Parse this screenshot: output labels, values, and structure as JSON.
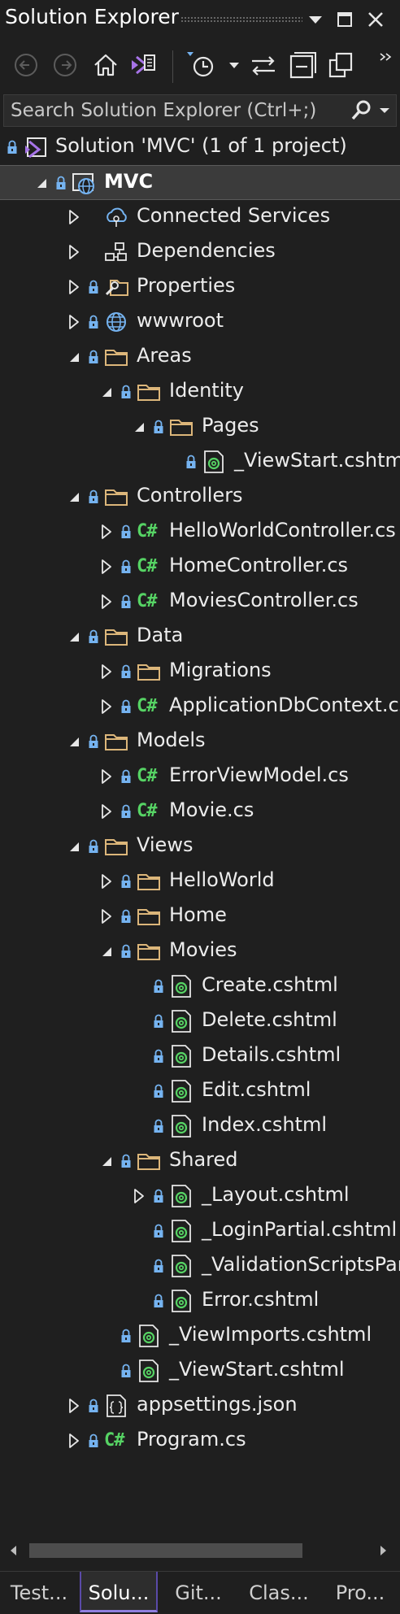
{
  "window": {
    "title": "Solution Explorer"
  },
  "search": {
    "placeholder": "Search Solution Explorer (Ctrl+;)"
  },
  "tree": [
    {
      "label": "Solution 'MVC' (1 of 1 project)",
      "icon": "solution-icon",
      "expander": "none",
      "lock": true,
      "selected": false,
      "depth": 0
    },
    {
      "label": "MVC",
      "icon": "web-project-icon",
      "expander": "expanded",
      "lock": true,
      "selected": true,
      "bold": true,
      "depth": 1
    },
    {
      "label": "Connected Services",
      "icon": "connected-services-icon",
      "expander": "collapsed",
      "lock": false,
      "depth": 2
    },
    {
      "label": "Dependencies",
      "icon": "dependencies-icon",
      "expander": "collapsed",
      "lock": false,
      "depth": 2
    },
    {
      "label": "Properties",
      "icon": "properties-folder-icon",
      "expander": "collapsed",
      "lock": true,
      "depth": 2
    },
    {
      "label": "wwwroot",
      "icon": "globe-icon",
      "expander": "collapsed",
      "lock": true,
      "depth": 2
    },
    {
      "label": "Areas",
      "icon": "folder-icon",
      "expander": "expanded",
      "lock": true,
      "depth": 2
    },
    {
      "label": "Identity",
      "icon": "folder-icon",
      "expander": "expanded",
      "lock": true,
      "depth": 3
    },
    {
      "label": "Pages",
      "icon": "folder-icon",
      "expander": "expanded",
      "lock": true,
      "depth": 4
    },
    {
      "label": "_ViewStart.cshtml",
      "icon": "razor-file-icon",
      "expander": "none",
      "lock": true,
      "depth": 5
    },
    {
      "label": "Controllers",
      "icon": "folder-icon",
      "expander": "expanded",
      "lock": true,
      "depth": 2
    },
    {
      "label": "HelloWorldController.cs",
      "icon": "csharp-file-icon",
      "expander": "collapsed",
      "lock": true,
      "depth": 3
    },
    {
      "label": "HomeController.cs",
      "icon": "csharp-file-icon",
      "expander": "collapsed",
      "lock": true,
      "depth": 3
    },
    {
      "label": "MoviesController.cs",
      "icon": "csharp-file-icon",
      "expander": "collapsed",
      "lock": true,
      "depth": 3
    },
    {
      "label": "Data",
      "icon": "folder-icon",
      "expander": "expanded",
      "lock": true,
      "depth": 2
    },
    {
      "label": "Migrations",
      "icon": "folder-icon",
      "expander": "collapsed",
      "lock": true,
      "depth": 3
    },
    {
      "label": "ApplicationDbContext.cs",
      "icon": "csharp-file-icon",
      "expander": "collapsed",
      "lock": true,
      "depth": 3
    },
    {
      "label": "Models",
      "icon": "folder-icon",
      "expander": "expanded",
      "lock": true,
      "depth": 2
    },
    {
      "label": "ErrorViewModel.cs",
      "icon": "csharp-file-icon",
      "expander": "collapsed",
      "lock": true,
      "depth": 3
    },
    {
      "label": "Movie.cs",
      "icon": "csharp-file-icon",
      "expander": "collapsed",
      "lock": true,
      "depth": 3
    },
    {
      "label": "Views",
      "icon": "folder-icon",
      "expander": "expanded",
      "lock": true,
      "depth": 2
    },
    {
      "label": "HelloWorld",
      "icon": "folder-icon",
      "expander": "collapsed",
      "lock": true,
      "depth": 3
    },
    {
      "label": "Home",
      "icon": "folder-icon",
      "expander": "collapsed",
      "lock": true,
      "depth": 3
    },
    {
      "label": "Movies",
      "icon": "folder-icon",
      "expander": "expanded",
      "lock": true,
      "depth": 3
    },
    {
      "label": "Create.cshtml",
      "icon": "razor-file-icon",
      "expander": "none",
      "lock": true,
      "depth": 4
    },
    {
      "label": "Delete.cshtml",
      "icon": "razor-file-icon",
      "expander": "none",
      "lock": true,
      "depth": 4
    },
    {
      "label": "Details.cshtml",
      "icon": "razor-file-icon",
      "expander": "none",
      "lock": true,
      "depth": 4
    },
    {
      "label": "Edit.cshtml",
      "icon": "razor-file-icon",
      "expander": "none",
      "lock": true,
      "depth": 4
    },
    {
      "label": "Index.cshtml",
      "icon": "razor-file-icon",
      "expander": "none",
      "lock": true,
      "depth": 4
    },
    {
      "label": "Shared",
      "icon": "folder-icon",
      "expander": "expanded",
      "lock": true,
      "depth": 3
    },
    {
      "label": "_Layout.cshtml",
      "icon": "razor-file-icon",
      "expander": "collapsed",
      "lock": true,
      "depth": 4
    },
    {
      "label": "_LoginPartial.cshtml",
      "icon": "razor-file-icon",
      "expander": "none",
      "lock": true,
      "depth": 4
    },
    {
      "label": "_ValidationScriptsPartial.cshtml",
      "icon": "razor-file-icon",
      "expander": "none",
      "lock": true,
      "depth": 4
    },
    {
      "label": "Error.cshtml",
      "icon": "razor-file-icon",
      "expander": "none",
      "lock": true,
      "depth": 4
    },
    {
      "label": "_ViewImports.cshtml",
      "icon": "razor-file-icon",
      "expander": "none",
      "lock": true,
      "depth": 3
    },
    {
      "label": "_ViewStart.cshtml",
      "icon": "razor-file-icon",
      "expander": "none",
      "lock": true,
      "depth": 3
    },
    {
      "label": "appsettings.json",
      "icon": "json-file-icon",
      "expander": "collapsed",
      "lock": true,
      "depth": 2
    },
    {
      "label": "Program.cs",
      "icon": "csharp-file-icon",
      "expander": "collapsed",
      "lock": true,
      "depth": 2
    }
  ],
  "csharp_badge": "C#",
  "json_badge": "{}",
  "razor_badge": "@",
  "tabs": [
    {
      "label": "Test...",
      "active": false
    },
    {
      "label": "Solu...",
      "active": true
    },
    {
      "label": "Git...",
      "active": false
    },
    {
      "label": "Clas...",
      "active": false
    },
    {
      "label": "Pro...",
      "active": false
    }
  ],
  "colors": {
    "background": "#1f1f1f",
    "folder": "#dcb67a",
    "lock": "#75b3f0",
    "csharp": "#56d364",
    "razor": "#56d364",
    "accent": "#8f7fe0",
    "solution": "#a774e8"
  }
}
